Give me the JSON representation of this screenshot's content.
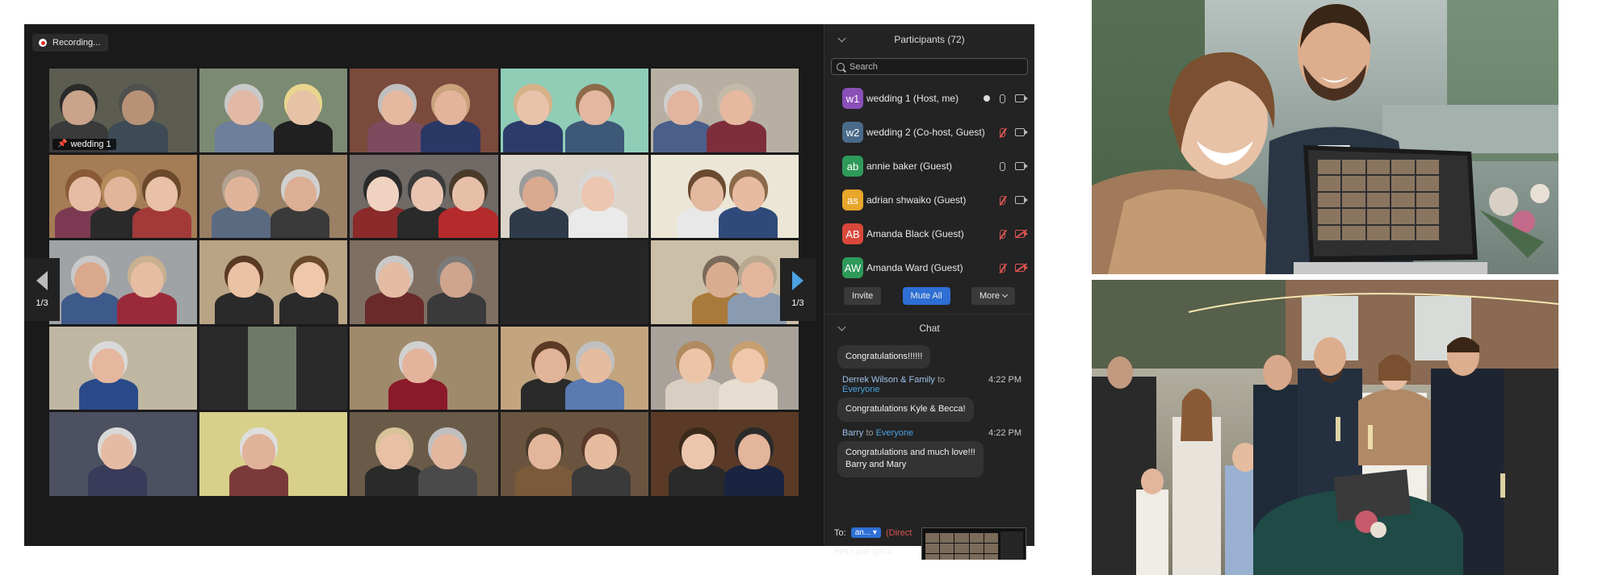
{
  "recording": {
    "label": "Recording..."
  },
  "gallery": {
    "page_left": "1/3",
    "page_right": "1/3",
    "active_tile_name": "wedding 1",
    "tiles": [
      {
        "bg": "#5c5c50",
        "p": [
          [
            "#c9a48a",
            "#2a2a2a",
            20,
            "#3a3a3a"
          ],
          [
            "#b89276",
            "#505050",
            60,
            "#3e4a55"
          ]
        ]
      },
      {
        "bg": "#7b8a72",
        "p": [
          [
            "#e2b9a4",
            "#c9c9c9",
            30,
            "#6d7f9a"
          ],
          [
            "#e6c2a6",
            "#e8d68e",
            70,
            "#202020"
          ]
        ]
      },
      {
        "bg": "#7a4a3c",
        "p": [
          [
            "#e4b9a0",
            "#bfbfbf",
            32,
            "#7e4b5e"
          ],
          [
            "#e3b49b",
            "#c9a27c",
            68,
            "#2a3866"
          ]
        ]
      },
      {
        "bg": "#8fcdb7",
        "p": [
          [
            "#e8c2aa",
            "#d6b28a",
            22,
            "#2c3c6a"
          ],
          [
            "#e4b7a1",
            "#8c6a4a",
            64,
            "#3e5878"
          ]
        ]
      },
      {
        "bg": "#b7b0a2",
        "p": [
          [
            "#e1b59f",
            "#cfcfcf",
            22,
            "#4a5f8a"
          ],
          [
            "#e6b8a0",
            "#c5b9a9",
            58,
            "#7d2e3a"
          ]
        ]
      },
      {
        "bg": "#a47c56",
        "p": [
          [
            "#e6bca4",
            "#8a5a36",
            24,
            "#7b3a52"
          ],
          [
            "#e2b59a",
            "#b58a5a",
            48,
            "#2a2a2a"
          ],
          [
            "#e9c1a8",
            "#6a4a2a",
            76,
            "#a33a3a"
          ]
        ]
      },
      {
        "bg": "#9a8064",
        "p": [
          [
            "#e0b49a",
            "#b0a090",
            28,
            "#5a6a80"
          ],
          [
            "#dcae93",
            "#d0d0d0",
            68,
            "#3a3a3a"
          ]
        ]
      },
      {
        "bg": "#6f6a66",
        "p": [
          [
            "#f0d2c0",
            "#2a2a2a",
            22,
            "#8a2a2a"
          ],
          [
            "#e9c4b0",
            "#3a3a3a",
            52,
            "#2a2a2a"
          ],
          [
            "#e6bfa8",
            "#4a3a2a",
            80,
            "#b52a2a"
          ]
        ]
      },
      {
        "bg": "#dcd4c8",
        "p": [
          [
            "#d9a990",
            "#9a9a9a",
            26,
            "#2f3b4a"
          ],
          [
            "#ecc6b0",
            "#d8d8d8",
            66,
            "#eaeaea"
          ]
        ]
      },
      {
        "bg": "#ece6d6",
        "p": [
          [
            "#e3b9a0",
            "#6a4a30",
            38,
            "#e8e8e8"
          ],
          [
            "#e6bba0",
            "#8a6a4a",
            66,
            "#2f4a7a"
          ]
        ]
      },
      {
        "bg": "#9fa3a6",
        "p": [
          [
            "#d9a88d",
            "#c9c9c9",
            28,
            "#3e5a8a"
          ],
          [
            "#e6bca2",
            "#c8b090",
            66,
            "#9a2a3a"
          ]
        ]
      },
      {
        "bg": "#b9a486",
        "p": [
          [
            "#ecc2a4",
            "#5a3a24",
            30,
            "#2a2a2a"
          ],
          [
            "#efc8ac",
            "#6a4a2a",
            74,
            "#2a2a2a"
          ]
        ]
      },
      {
        "bg": "#7f6f62",
        "p": [
          [
            "#e4bba3",
            "#c8c8c8",
            30,
            "#6a2a2a"
          ],
          [
            "#cfa58e",
            "#7a7a7a",
            72,
            "#3a3a3a"
          ]
        ]
      },
      {
        "empty": true
      },
      {
        "bg": "#cbbfa8",
        "p": [
          [
            "#d9ad90",
            "#7a6a5a",
            48,
            "#aa7a3a"
          ],
          [
            "#e3b59c",
            "#b8a890",
            72,
            "#8a9ab0"
          ]
        ]
      },
      {
        "bg": "#c0b7a2",
        "p": [
          [
            "#e5b79f",
            "#d9d9d9",
            40,
            "#2a4a8a"
          ]
        ]
      },
      {
        "bg": "#2a2a2a",
        "photo": "#6f7a66"
      },
      {
        "bg": "#a08a6c",
        "p": [
          [
            "#e3b39b",
            "#d0d0d0",
            46,
            "#8a1a2a"
          ]
        ]
      },
      {
        "bg": "#c2a57e",
        "p": [
          [
            "#e2b49a",
            "#5a3a24",
            34,
            "#2a2a2a"
          ],
          [
            "#e6bca0",
            "#c0c0c0",
            64,
            "#5a7ab0"
          ]
        ]
      },
      {
        "bg": "#a8a29a",
        "p": [
          [
            "#ecc4a8",
            "#b08a60",
            30,
            "#d8cfc2"
          ],
          [
            "#efc8ac",
            "#c8a070",
            66,
            "#e6ddd0"
          ]
        ]
      },
      {
        "bg": "#4c5060",
        "p": [
          [
            "#e6bba3",
            "#d8d8d8",
            46,
            "#3a3a5a"
          ]
        ]
      },
      {
        "bg": "#d8d08a",
        "p": [
          [
            "#e0b29a",
            "#dedede",
            40,
            "#7a3a3a"
          ]
        ]
      },
      {
        "bg": "#6a5a48",
        "p": [
          [
            "#e8c0a6",
            "#d8c29a",
            30,
            "#2a2a2a"
          ],
          [
            "#e3b79e",
            "#bfbfbf",
            66,
            "#4a4a4a"
          ]
        ]
      },
      {
        "bg": "#6a5440",
        "p": [
          [
            "#e3b69c",
            "#4a3a2a",
            30,
            "#7a5a3a"
          ],
          [
            "#e6bba0",
            "#5a3a2a",
            68,
            "#3a3a3a"
          ]
        ]
      },
      {
        "bg": "#5a3a26",
        "p": [
          [
            "#ecc6ac",
            "#3a2a1a",
            32,
            "#2a2a2a"
          ],
          [
            "#e3b59a",
            "#2a2a2a",
            70,
            "#1a2440"
          ]
        ]
      }
    ]
  },
  "participants": {
    "title": "Participants (72)",
    "search_placeholder": "Search",
    "list": [
      {
        "initials": "w1",
        "color": "#8b4fb8",
        "name": "wedding 1 (Host, me)",
        "mic": "on",
        "cam": "on",
        "share": true
      },
      {
        "initials": "w2",
        "color": "#4a6a8a",
        "name": "wedding 2  (Co-host, Guest)",
        "mic": "muted",
        "cam": "on",
        "share": false
      },
      {
        "initials": "ab",
        "color": "#2e9a5a",
        "name": "annie baker (Guest)",
        "mic": "on",
        "cam": "on",
        "share": false
      },
      {
        "initials": "as",
        "color": "#e8a62a",
        "name": "adrian shwaiko (Guest)",
        "mic": "muted",
        "cam": "on",
        "share": false
      },
      {
        "initials": "AB",
        "color": "#d9483b",
        "name": "Amanda Black (Guest)",
        "mic": "muted",
        "cam": "off",
        "share": false
      },
      {
        "initials": "AW",
        "color": "#2e9a5a",
        "name": "Amanda Ward (Guest)",
        "mic": "muted",
        "cam": "off",
        "share": false
      }
    ],
    "invite_label": "Invite",
    "mute_all_label": "Mute All",
    "more_label": "More"
  },
  "chat": {
    "title": "Chat",
    "messages": [
      {
        "text": "Congratulations!!!!!!"
      },
      {
        "sender": "Derrek Wilson & Family",
        "to_word": "to",
        "recipient": "Everyone",
        "time": "4:22 PM",
        "text": "Congratulations Kyle & Becca!"
      },
      {
        "sender": "Barry",
        "to_word": "to",
        "recipient": "Everyone",
        "time": "4:22 PM",
        "text": "Congratulations and much love!!!",
        "text2": "Barry and Mary"
      }
    ],
    "to_label": "To:",
    "to_recipient": "an...",
    "direct_label": "(Direct",
    "compose_text": "Yes I just got a"
  },
  "colors": {
    "zoom_bg": "#1a1a1a",
    "panel_bg": "#232323",
    "accent_blue": "#2d6fd4",
    "active_speaker": "#d6e66a",
    "muted_red": "#d9534f"
  }
}
